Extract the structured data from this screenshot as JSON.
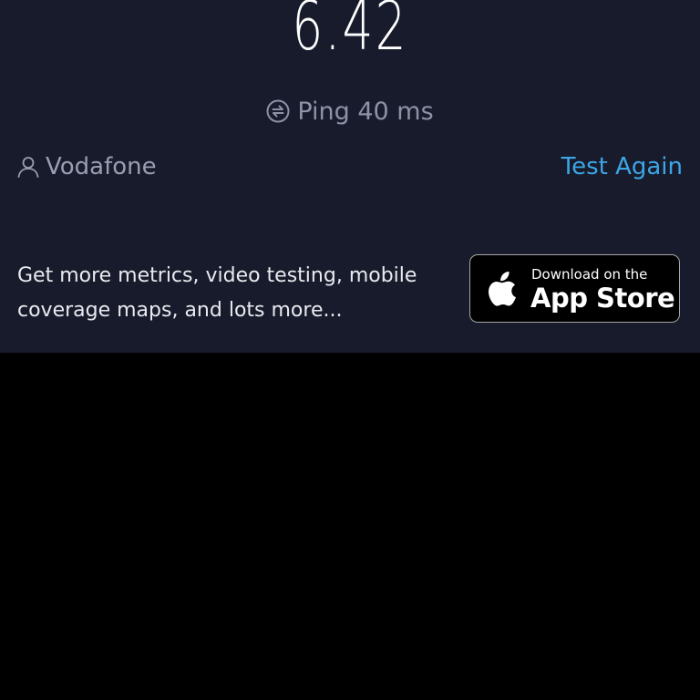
{
  "result": {
    "speed_value": "6.42"
  },
  "ping": {
    "label": "Ping 40 ms",
    "icon": "ping-icon"
  },
  "provider": {
    "name": "Vodafone",
    "icon": "user-icon"
  },
  "actions": {
    "test_again_label": "Test Again"
  },
  "promo": {
    "text": "Get more metrics, video testing, mobile coverage maps, and lots more..."
  },
  "app_store_badge": {
    "small_label": "Download on the",
    "big_label": "App Store",
    "icon": "apple-icon"
  },
  "colors": {
    "panel_background": "#181b2b",
    "page_background": "#000000",
    "accent": "#3da6e6",
    "muted_text": "#8e92a8"
  }
}
